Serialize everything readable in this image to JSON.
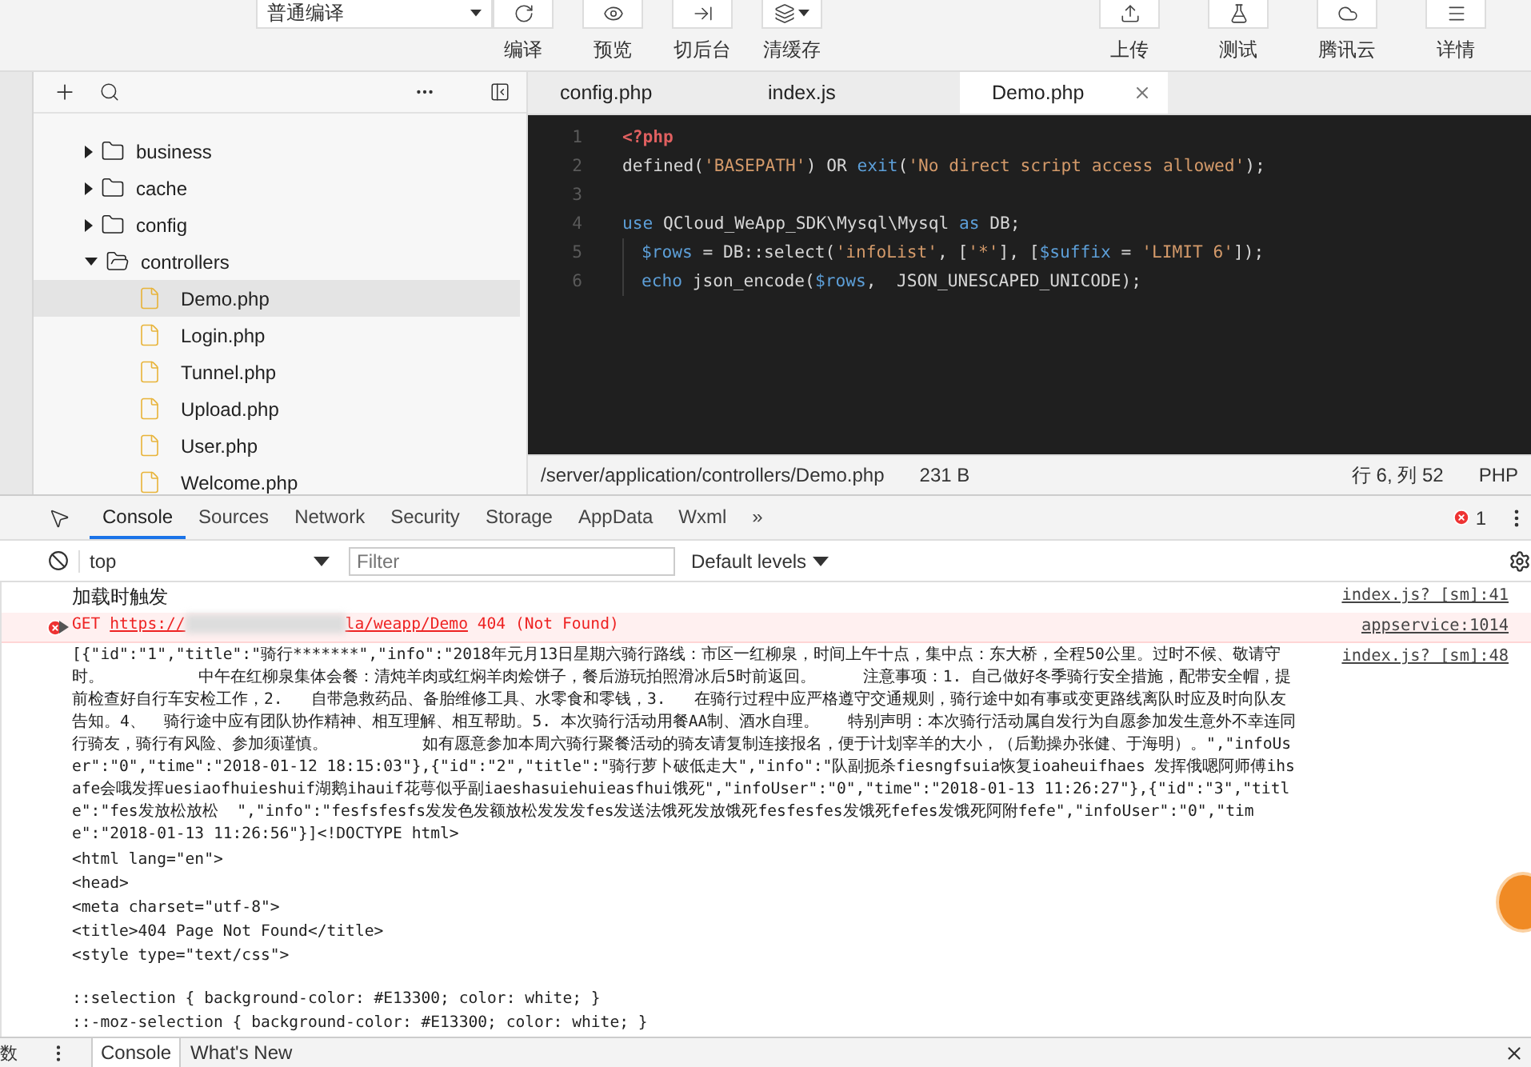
{
  "toolbar": {
    "compile_mode": "普通编译",
    "left_buttons": [
      {
        "label": "编译"
      },
      {
        "label": "预览"
      },
      {
        "label": "切后台"
      },
      {
        "label": "清缓存"
      }
    ],
    "right_buttons": [
      {
        "label": "上传"
      },
      {
        "label": "测试"
      },
      {
        "label": "腾讯云"
      },
      {
        "label": "详情"
      }
    ]
  },
  "file_tree": {
    "items": [
      {
        "kind": "folder",
        "name": "business",
        "expanded": false,
        "selected": false
      },
      {
        "kind": "folder",
        "name": "cache",
        "expanded": false,
        "selected": false
      },
      {
        "kind": "folder",
        "name": "config",
        "expanded": false,
        "selected": false
      },
      {
        "kind": "folder",
        "name": "controllers",
        "expanded": true,
        "selected": false,
        "children": [
          {
            "kind": "file",
            "name": "Demo.php",
            "selected": true
          },
          {
            "kind": "file",
            "name": "Login.php",
            "selected": false
          },
          {
            "kind": "file",
            "name": "Tunnel.php",
            "selected": false
          },
          {
            "kind": "file",
            "name": "Upload.php",
            "selected": false
          },
          {
            "kind": "file",
            "name": "User.php",
            "selected": false
          },
          {
            "kind": "file",
            "name": "Welcome.php",
            "selected": false
          }
        ]
      }
    ]
  },
  "editor": {
    "tabs": [
      {
        "label": "config.php",
        "selected": false
      },
      {
        "label": "index.js",
        "selected": false
      },
      {
        "label": "Demo.php",
        "selected": true
      }
    ],
    "lines": [
      {
        "number": "1",
        "indent": false,
        "tokens": [
          {
            "kind": "tag",
            "text": "<?php"
          }
        ]
      },
      {
        "number": "2",
        "indent": false,
        "tokens": [
          {
            "kind": "plain",
            "text": "defined("
          },
          {
            "kind": "string",
            "text": "'BASEPATH'"
          },
          {
            "kind": "plain",
            "text": ") OR "
          },
          {
            "kind": "keyword",
            "text": "exit"
          },
          {
            "kind": "plain",
            "text": "("
          },
          {
            "kind": "string",
            "text": "'No direct script access allowed'"
          },
          {
            "kind": "plain",
            "text": ");"
          }
        ]
      },
      {
        "number": "3",
        "indent": false
      },
      {
        "number": "4",
        "indent": false,
        "tokens": [
          {
            "kind": "keyword",
            "text": "use"
          },
          {
            "kind": "plain",
            "text": " QCloud_WeApp_SDK\\Mysql\\Mysql "
          },
          {
            "kind": "keyword",
            "text": "as"
          },
          {
            "kind": "plain",
            "text": " DB;"
          }
        ]
      },
      {
        "number": "5",
        "indent": true,
        "tokens": [
          {
            "kind": "variable",
            "text": "$rows"
          },
          {
            "kind": "plain",
            "text": " = DB::select("
          },
          {
            "kind": "string",
            "text": "'infoList'"
          },
          {
            "kind": "plain",
            "text": ", ["
          },
          {
            "kind": "string",
            "text": "'*'"
          },
          {
            "kind": "plain",
            "text": "], ["
          },
          {
            "kind": "variable",
            "text": "$suffix"
          },
          {
            "kind": "plain",
            "text": " = "
          },
          {
            "kind": "string",
            "text": "'LIMIT 6'"
          },
          {
            "kind": "plain",
            "text": "]);"
          }
        ]
      },
      {
        "number": "6",
        "indent": true,
        "tokens": [
          {
            "kind": "keyword",
            "text": "echo"
          },
          {
            "kind": "plain",
            "text": " json_encode("
          },
          {
            "kind": "variable",
            "text": "$rows"
          },
          {
            "kind": "plain",
            "text": ",  JSON_UNESCAPED_UNICODE);"
          }
        ]
      }
    ],
    "status_bar": {
      "path": "/server/application/controllers/Demo.php",
      "size": "231 B",
      "cursor": "行 6, 列 52",
      "language": "PHP"
    }
  },
  "devtools": {
    "tabs": [
      {
        "label": "Console",
        "selected": true
      },
      {
        "label": "Sources",
        "selected": false
      },
      {
        "label": "Network",
        "selected": false
      },
      {
        "label": "Security",
        "selected": false
      },
      {
        "label": "Storage",
        "selected": false
      },
      {
        "label": "AppData",
        "selected": false
      },
      {
        "label": "Wxml",
        "selected": false
      }
    ],
    "more": "»",
    "error_count": "1",
    "context": "top",
    "filter_placeholder": "Filter",
    "levels": "Default levels",
    "messages": [
      {
        "kind": "log",
        "text": "加载时触发",
        "source": "index.js? [sm]:41"
      },
      {
        "kind": "error",
        "method": "GET",
        "url_start": "https://",
        "url_end": "la/weapp/Demo",
        "status": "404 (Not Found)",
        "source": "appservice:1014"
      },
      {
        "kind": "output",
        "source": "index.js? [sm]:48",
        "text": "[{\"id\":\"1\",\"title\":\"骑行*******\",\"info\":\"2018年元月13日星期六骑行路线：市区一红柳泉，时间上午十点，集中点：东大桥，全程50公里。过时不候、敬请守时。          中午在红柳泉集体会餐：清炖羊肉或红焖羊肉烩饼子，餐后游玩拍照滑冰后5时前返回。     注意事项：1. 自己做好冬季骑行安全措施，配带安全帽，提前检查好自行车安检工作，2.   自带急救药品、备胎维修工具、水零食和零钱，3.   在骑行过程中应严格遵守交通规则，骑行途中如有事或变更路线离队时应及时向队友告知。4、  骑行途中应有团队协作精神、相互理解、相互帮助。5. 本次骑行活动用餐AA制、酒水自理。   特别声明：本次骑行活动属自发行为自愿参加发生意外不幸连同行骑友，骑行有风险、参加须谨慎。          如有愿意参加本周六骑行聚餐活动的骑友请复制连接报名，便于计划宰羊的大小，（后勤操办张健、于海明）。\",\"infoUser\":\"0\",\"time\":\"2018-01-12 18:15:03\"},{\"id\":\"2\",\"title\":\"骑行萝卜破低走大\",\"info\":\"队副扼杀fiesngfsuia恢复ioaheuifhaes 发挥俄嗯阿师傅ihsafe会哦发挥uesiaofhuieshuif湖鹅ihauif花萼似乎副iaeshasuiehuieasfhui饿死\",\"infoUser\":\"0\",\"time\":\"2018-01-13 11:26:27\"},{\"id\":\"3\",\"title\":\"fes发放松放松  \",\"info\":\"fesfsfesfs发发色发额放松发发发fes发送法饿死发放饿死fesfesfes发饿死fefes发饿死阿附fefe\",\"infoUser\":\"0\",\"time\":\"2018-01-13 11:26:56\"}]<!DOCTYPE html>"
      },
      {
        "kind": "html",
        "text": "<html lang=\"en\">"
      },
      {
        "kind": "html",
        "text": "<head>"
      },
      {
        "kind": "html",
        "text": "<meta charset=\"utf-8\">"
      },
      {
        "kind": "html",
        "text": "<title>404 Page Not Found</title>"
      },
      {
        "kind": "html",
        "text": "<style type=\"text/css\">"
      },
      {
        "kind": "blank"
      },
      {
        "kind": "html",
        "text": "::selection { background-color: #E13300; color: white; }"
      },
      {
        "kind": "html",
        "text": "::-moz-selection { background-color: #E13300; color: white; }"
      }
    ]
  },
  "drawer": {
    "edge_text": "数",
    "tabs": [
      {
        "label": "Console",
        "selected": true
      },
      {
        "label": "What's New",
        "selected": false
      }
    ]
  }
}
